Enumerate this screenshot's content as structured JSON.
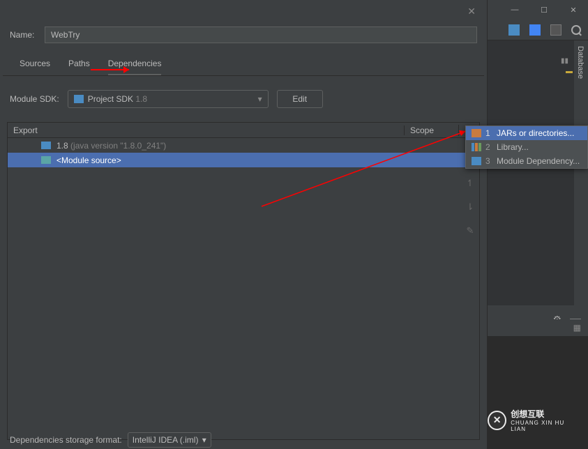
{
  "dialog": {
    "name_label": "Name:",
    "name_value": "WebTry",
    "tabs": [
      "Sources",
      "Paths",
      "Dependencies"
    ],
    "active_tab": 2,
    "sdk_label": "Module SDK:",
    "sdk_value": "Project SDK",
    "sdk_version": "1.8",
    "edit_button": "Edit",
    "table": {
      "col_export": "Export",
      "col_scope": "Scope",
      "rows": [
        {
          "icon": "folder-blue",
          "text": "1.8",
          "suffix": "(java version \"1.8.0_241\")",
          "selected": false
        },
        {
          "icon": "folder-teal",
          "text": "<Module source>",
          "suffix": "",
          "selected": true
        }
      ]
    },
    "storage_label": "Dependencies storage format:",
    "storage_value": "IntelliJ IDEA (.iml)"
  },
  "popup": {
    "items": [
      {
        "num": "1",
        "label": "JARs or directories...",
        "icon": "orange",
        "selected": true
      },
      {
        "num": "2",
        "label": "Library...",
        "icon": "bars",
        "selected": false
      },
      {
        "num": "3",
        "label": "Module Dependency...",
        "icon": "folder",
        "selected": false
      }
    ]
  },
  "right": {
    "db_label": "Database",
    "watermark_main": "创想互联",
    "watermark_sub": "CHUANG XIN HU LIAN"
  }
}
